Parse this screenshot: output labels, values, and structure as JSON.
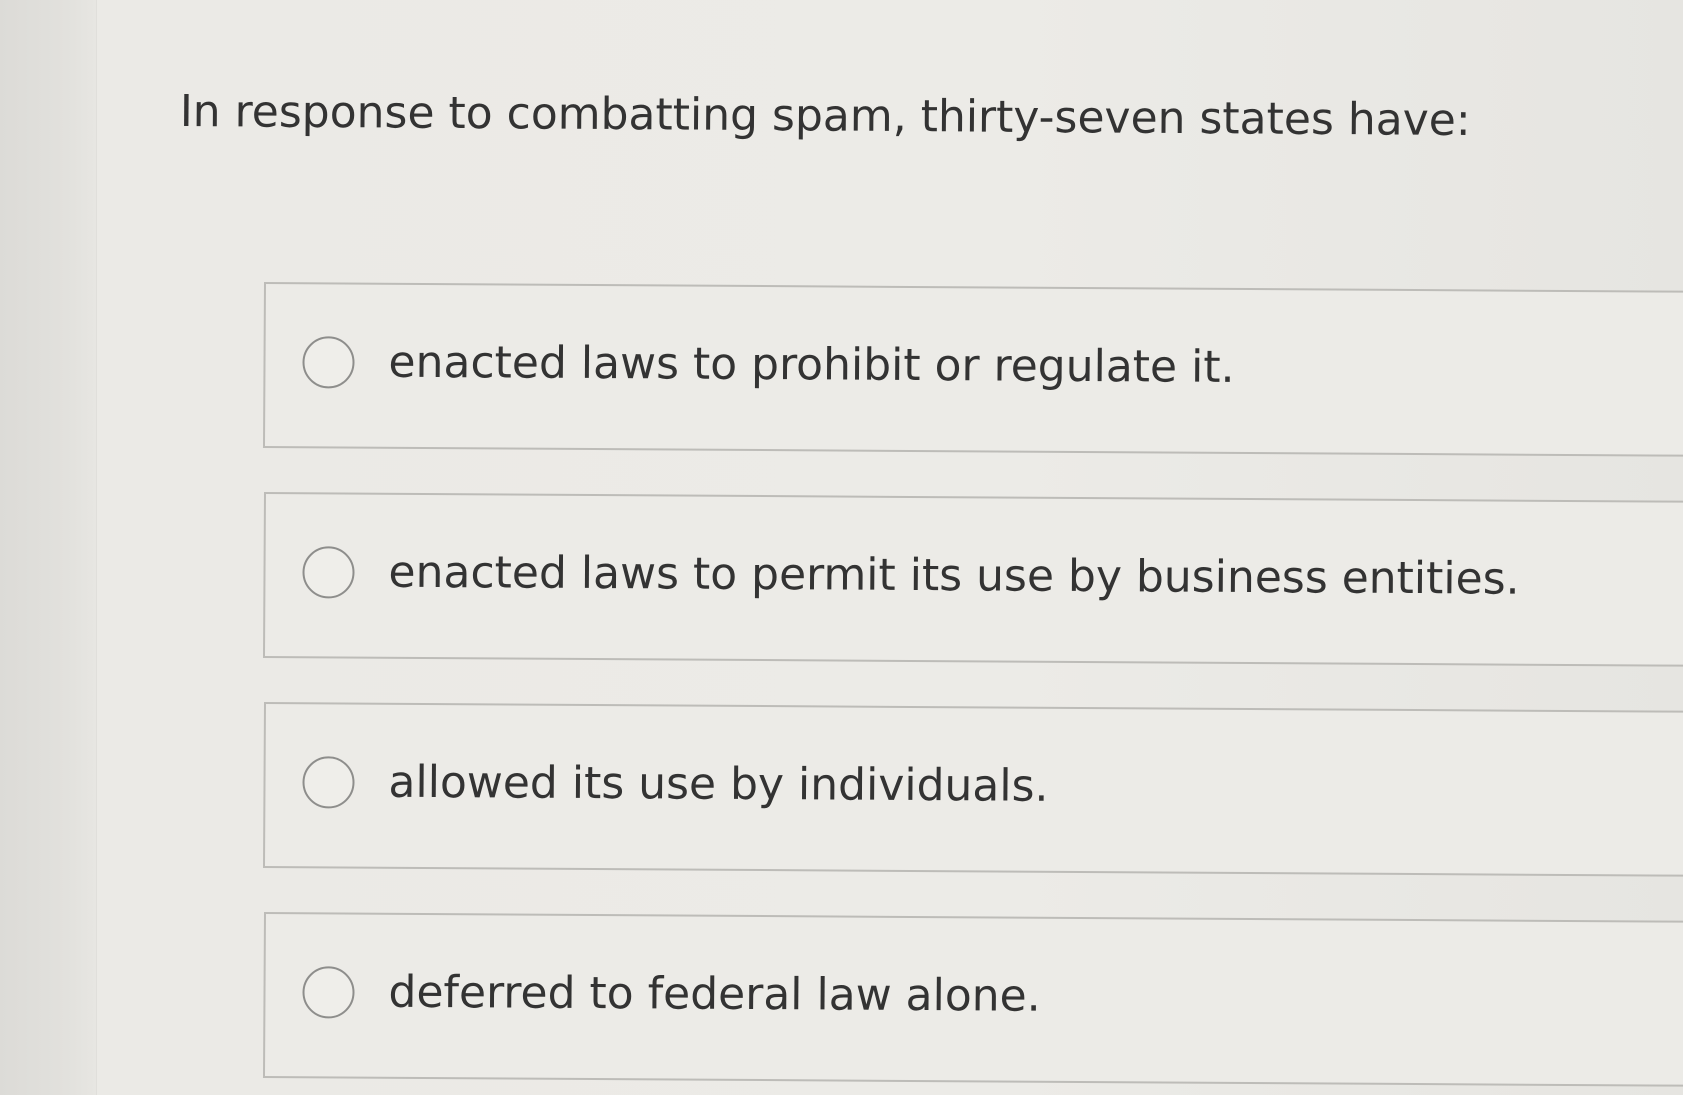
{
  "question": {
    "text": "In response to combatting spam, thirty-seven states have:"
  },
  "options": [
    {
      "label": "enacted laws to prohibit or regulate it.",
      "selected": false
    },
    {
      "label": "enacted laws to permit its use by business entities.",
      "selected": false
    },
    {
      "label": "allowed its use by individuals.",
      "selected": false
    },
    {
      "label": "deferred to federal law alone.",
      "selected": false
    }
  ]
}
